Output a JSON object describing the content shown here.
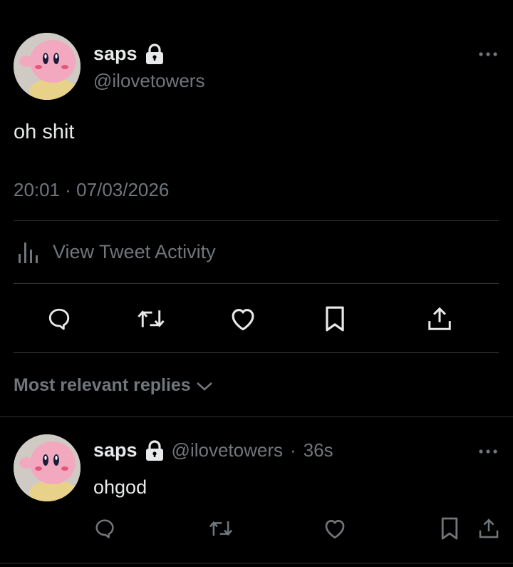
{
  "tweet": {
    "display_name": "saps",
    "handle": "@ilovetowers",
    "text": "oh shit",
    "timestamp": "20:01 · 07/03/2026",
    "more_icon": "more-dots-icon",
    "lock_icon": "lock-icon"
  },
  "activity": {
    "label": "View Tweet Activity",
    "icon": "bar-chart-icon"
  },
  "actions": [
    "reply-icon",
    "retweet-icon",
    "like-icon",
    "bookmark-icon",
    "share-icon"
  ],
  "replies_header": {
    "label": "Most relevant replies",
    "icon": "chevron-down-icon"
  },
  "reply": {
    "display_name": "saps",
    "handle": "@ilovetowers",
    "separator": "·",
    "time": "36s",
    "text": "ohgod"
  },
  "colors": {
    "background": "#000000",
    "text": "#e7e9ea",
    "secondary": "#71767b",
    "divider": "#2f3336"
  }
}
